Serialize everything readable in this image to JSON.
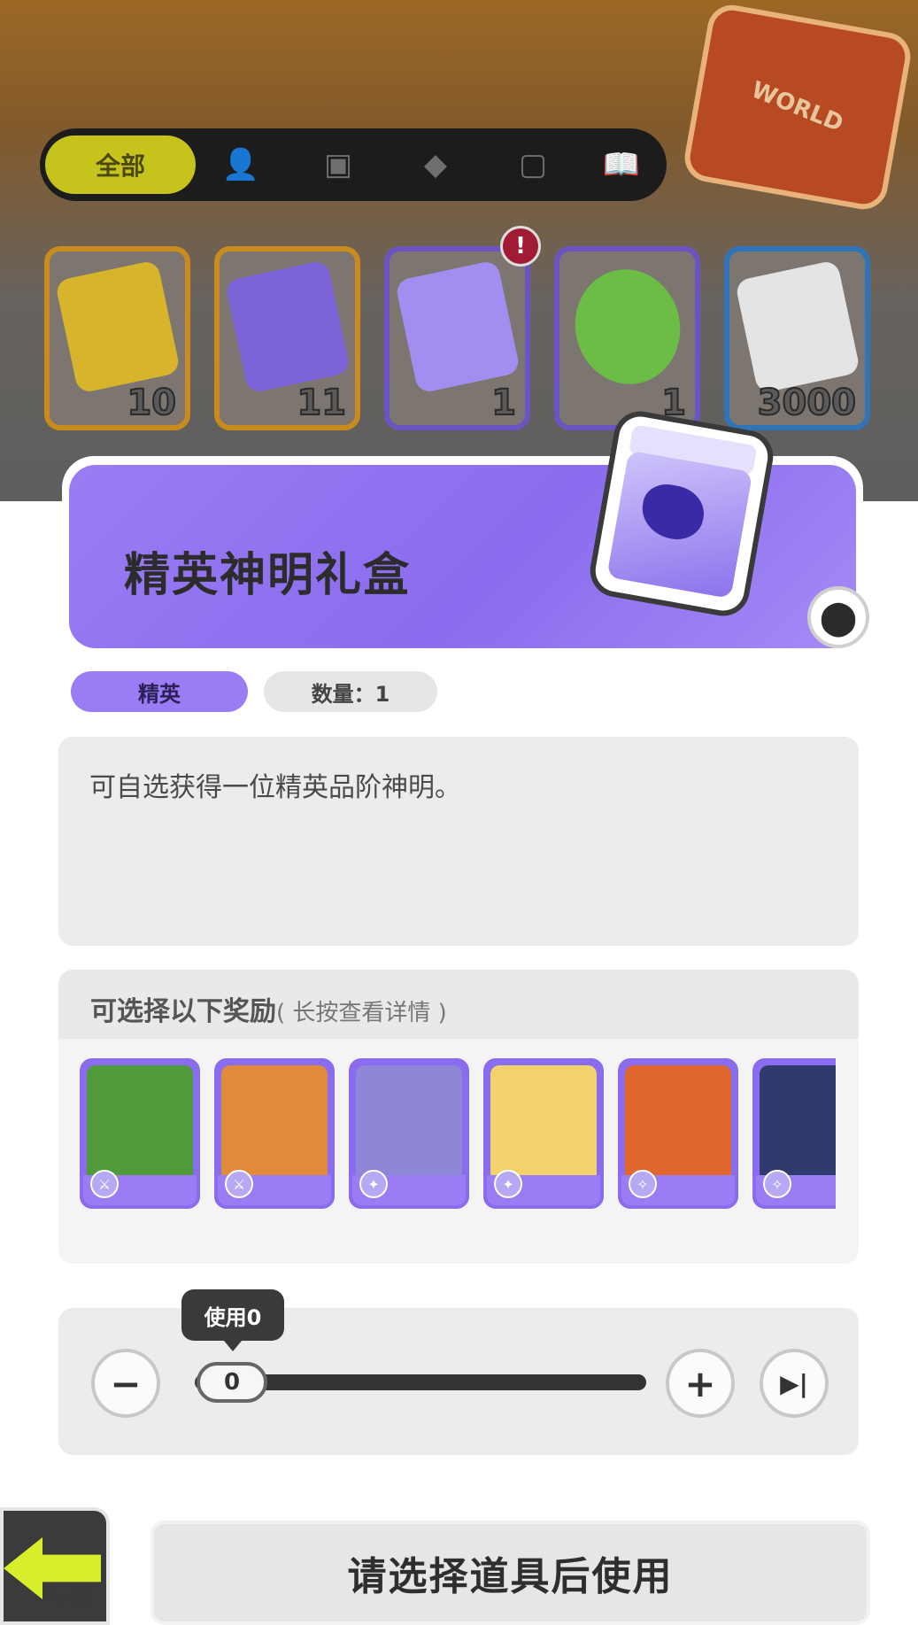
{
  "tabs": [
    {
      "label": "全部",
      "icon": "all"
    },
    {
      "label": "",
      "icon": "person-icon"
    },
    {
      "label": "",
      "icon": "box-icon"
    },
    {
      "label": "",
      "icon": "ticket-icon"
    },
    {
      "label": "",
      "icon": "card-icon"
    },
    {
      "label": "",
      "icon": "book-icon"
    }
  ],
  "bag_decoration": {
    "text": "WORLD"
  },
  "items": [
    {
      "name": "yellow-ticket",
      "count": "10",
      "border": "#c98a1e",
      "art": "#d8b32c"
    },
    {
      "name": "purple-ticket",
      "count": "11",
      "border": "#c98a1e",
      "art": "#7b62d6"
    },
    {
      "name": "elite-god-box",
      "count": "1",
      "border": "#6b54c2",
      "art": "#a18ef0"
    },
    {
      "name": "green-cup",
      "count": "1",
      "border": "#6b54c2",
      "art": "#6bbd45"
    },
    {
      "name": "paint-tube",
      "count": "3000",
      "border": "#2f74b8",
      "art": "#e4e4e4"
    }
  ],
  "notification": {
    "symbol": "!"
  },
  "detail": {
    "title": "精英神明礼盒",
    "rarity": "精英",
    "quantity": "数量：1",
    "description": "可自选获得一位精英品阶神明。"
  },
  "rewards": {
    "title": "可选择以下奖励",
    "hint": "( 长按查看详情 )",
    "heroes": [
      {
        "name": "hero-1",
        "color": "#4f9b3c",
        "class_icon": "sword-icon"
      },
      {
        "name": "hero-2",
        "color": "#e08a3a",
        "class_icon": "sword-icon"
      },
      {
        "name": "hero-3",
        "color": "#8f86d8",
        "class_icon": "gun-icon"
      },
      {
        "name": "hero-4",
        "color": "#f2d36b",
        "class_icon": "gun-icon"
      },
      {
        "name": "hero-5",
        "color": "#e0672d",
        "class_icon": "staff-icon"
      },
      {
        "name": "hero-6",
        "color": "#2f3a6e",
        "class_icon": "staff-icon"
      }
    ]
  },
  "use_control": {
    "tooltip": "使用0",
    "value": "0",
    "minus": "−",
    "plus": "+",
    "max": "▶|"
  },
  "back": {
    "label": "BACK"
  },
  "action": {
    "label": "请选择道具后使用"
  }
}
